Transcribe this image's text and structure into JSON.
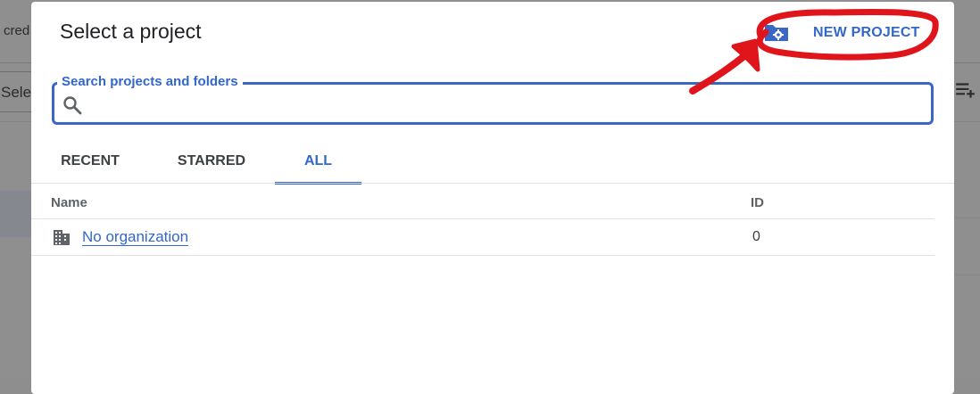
{
  "background": {
    "crumb_text": "cred",
    "select_text": "Sele"
  },
  "dialog": {
    "title": "Select a project",
    "new_project_label": "NEW PROJECT",
    "search": {
      "legend": "Search projects and folders",
      "value": "",
      "placeholder": ""
    },
    "tabs": [
      {
        "label": "RECENT",
        "active": false
      },
      {
        "label": "STARRED",
        "active": false
      },
      {
        "label": "ALL",
        "active": true
      }
    ],
    "table": {
      "headers": {
        "name": "Name",
        "id": "ID"
      },
      "rows": [
        {
          "name": "No organization",
          "id": "0",
          "icon": "building-icon"
        }
      ]
    }
  },
  "icons": {
    "new_project": "folder-settings-icon",
    "search": "search-icon",
    "background_right": "playlist-add-icon"
  },
  "colors": {
    "accent": "#3367c9",
    "annotation": "#e0141b",
    "scrim": "#8e8e8e"
  }
}
